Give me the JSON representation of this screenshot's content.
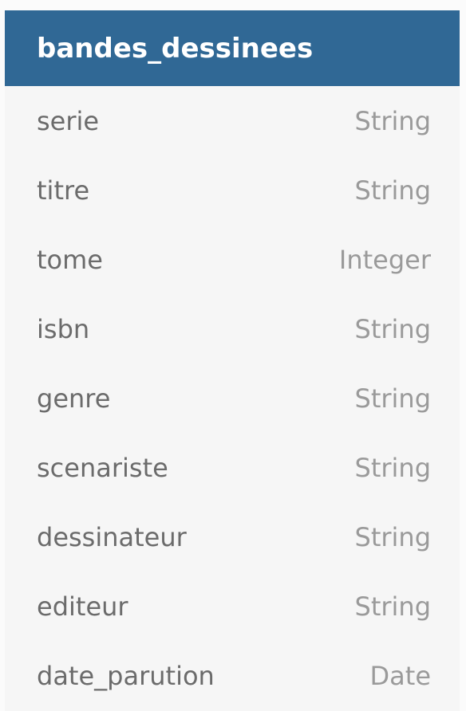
{
  "table": {
    "name": "bandes_dessinees",
    "header_color": "#306895",
    "fields": [
      {
        "name": "serie",
        "type": "String"
      },
      {
        "name": "titre",
        "type": "String"
      },
      {
        "name": "tome",
        "type": "Integer"
      },
      {
        "name": "isbn",
        "type": "String"
      },
      {
        "name": "genre",
        "type": "String"
      },
      {
        "name": "scenariste",
        "type": "String"
      },
      {
        "name": "dessinateur",
        "type": "String"
      },
      {
        "name": "editeur",
        "type": "String"
      },
      {
        "name": "date_parution",
        "type": "Date"
      }
    ]
  }
}
